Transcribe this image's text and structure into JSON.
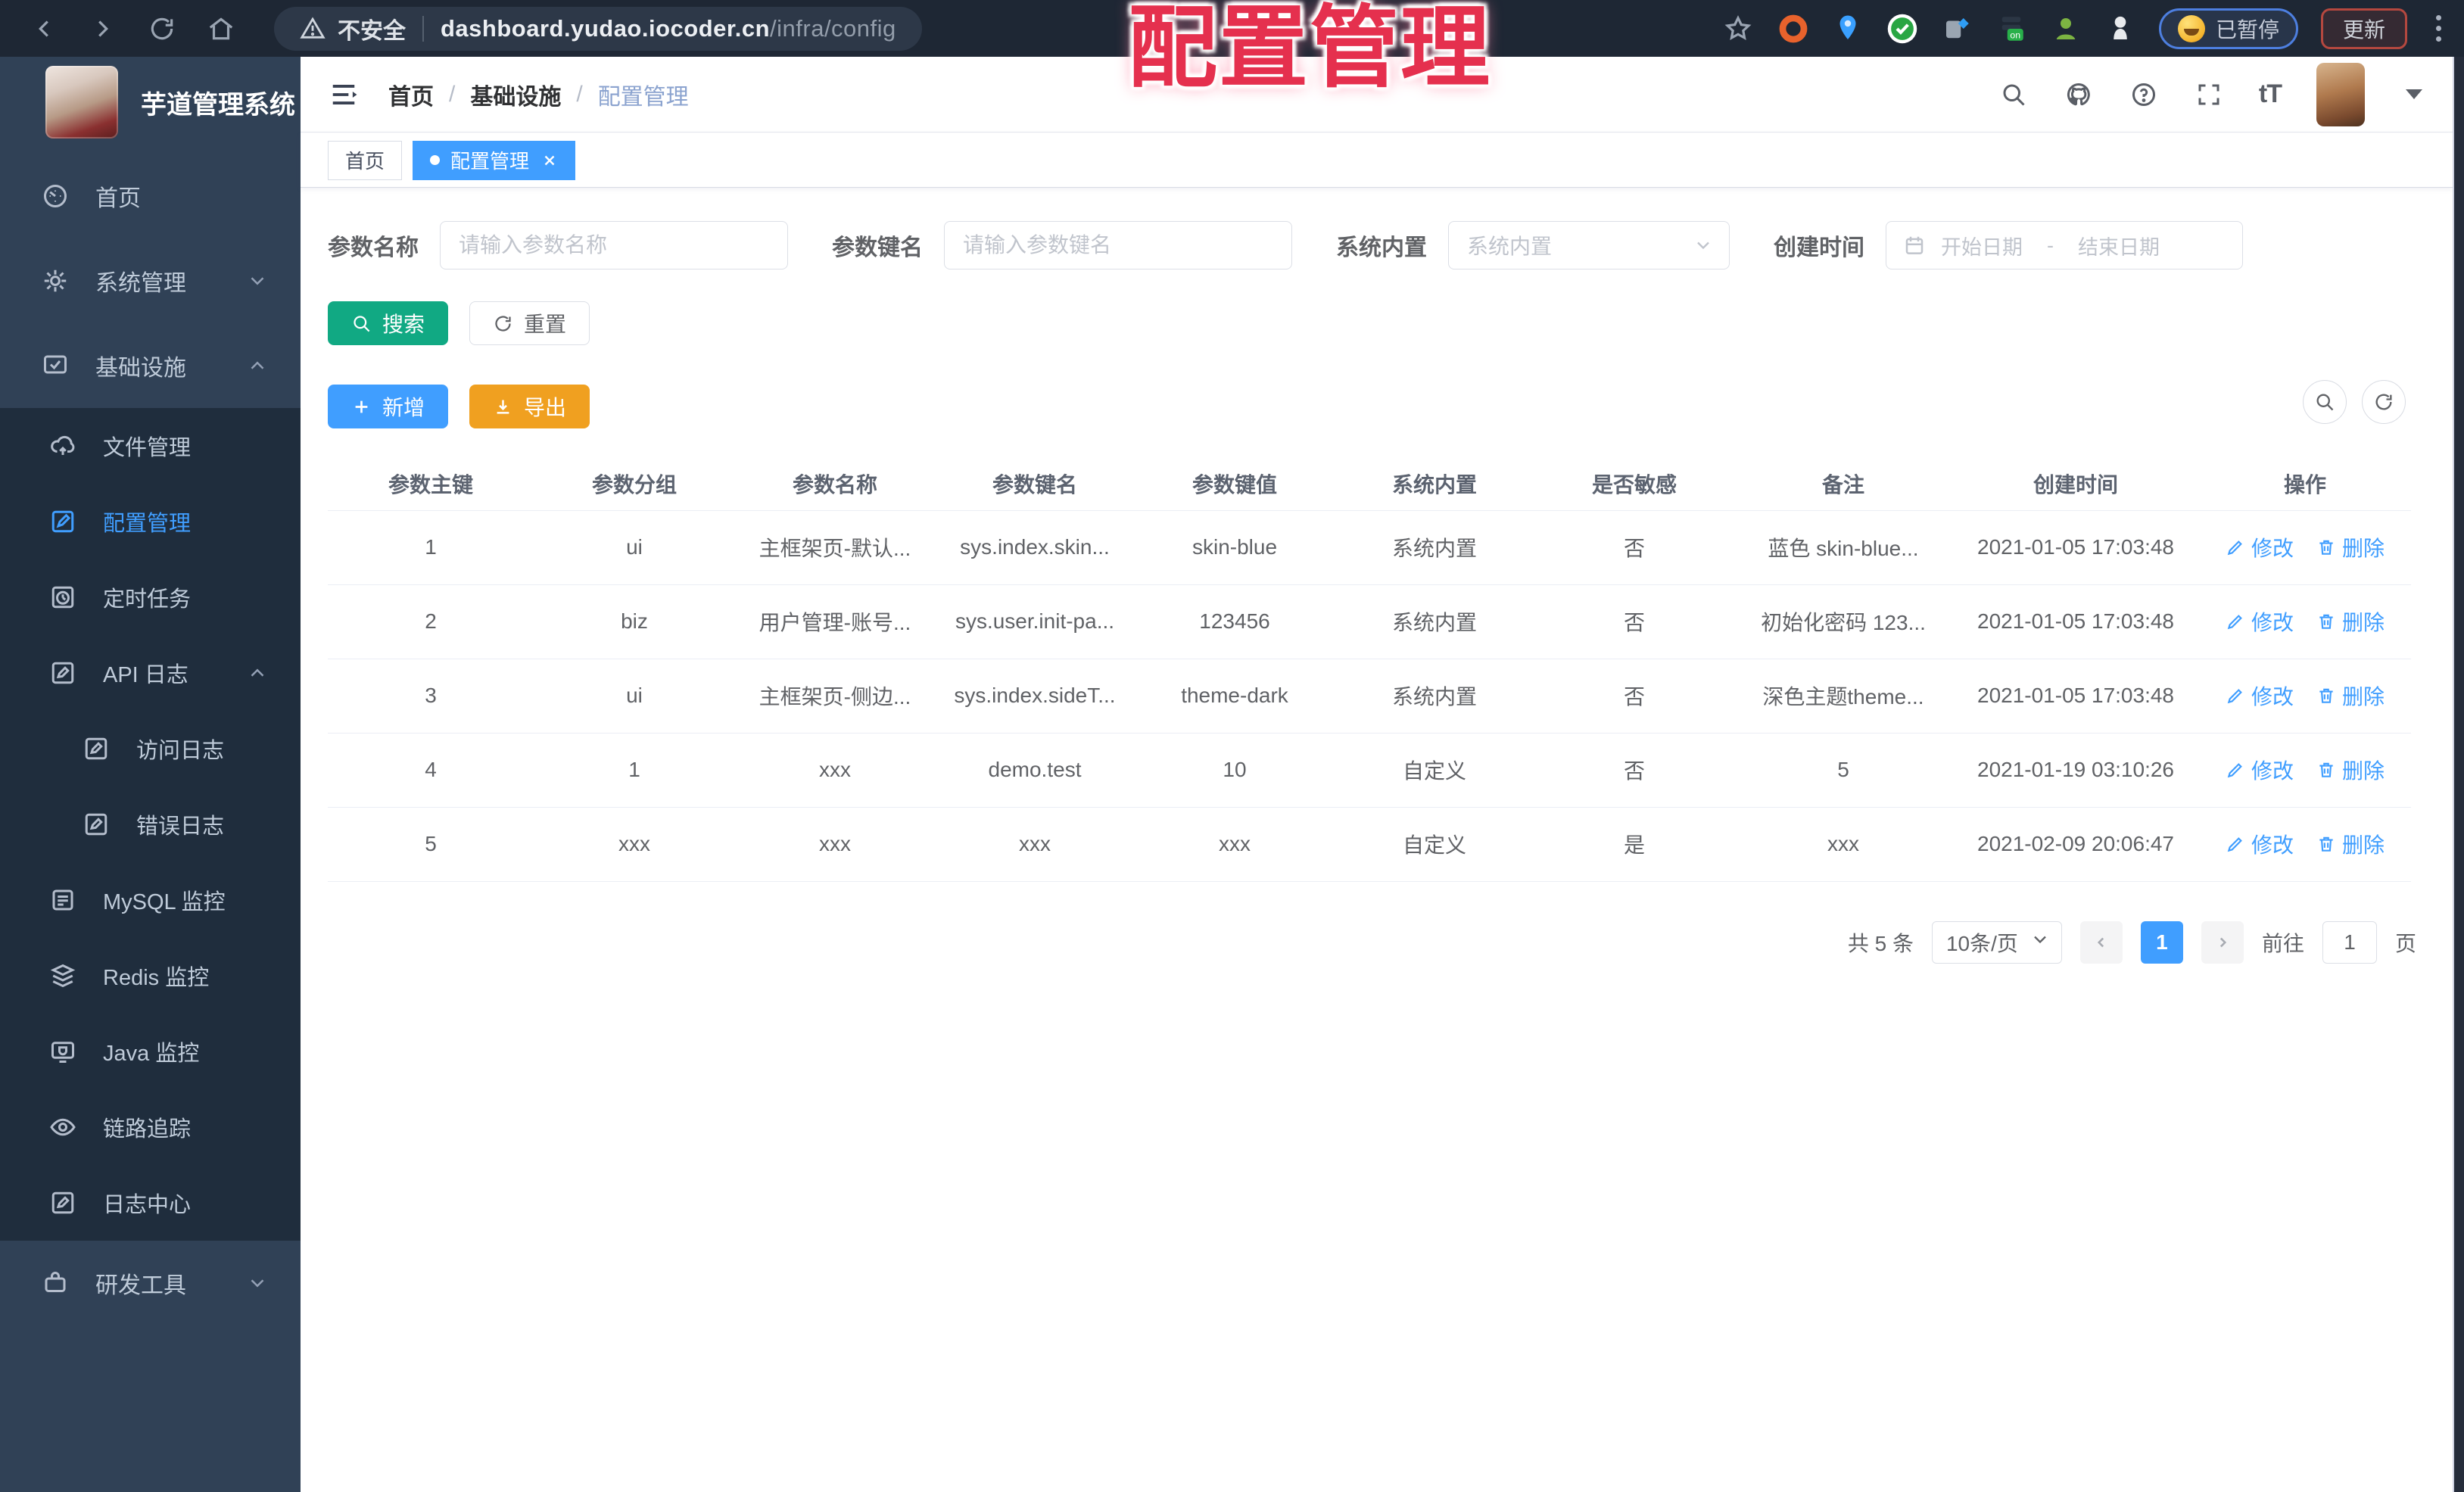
{
  "browser": {
    "security_label": "不安全",
    "url_domain": "dashboard.yudao.iocoder.cn",
    "url_path": "/infra/config",
    "paused_badge": "已暂停",
    "update_label": "更新"
  },
  "overlay_title": "配置管理",
  "sidebar": {
    "app_title": "芋道管理系统",
    "items": [
      {
        "label": "首页"
      },
      {
        "label": "系统管理"
      },
      {
        "label": "基础设施"
      }
    ],
    "sub_items": [
      {
        "label": "文件管理"
      },
      {
        "label": "配置管理"
      },
      {
        "label": "定时任务"
      },
      {
        "label": "API 日志"
      },
      {
        "label": "访问日志"
      },
      {
        "label": "错误日志"
      },
      {
        "label": "MySQL 监控"
      },
      {
        "label": "Redis 监控"
      },
      {
        "label": "Java 监控"
      },
      {
        "label": "链路追踪"
      },
      {
        "label": "日志中心"
      }
    ],
    "dev_tools_label": "研发工具"
  },
  "header": {
    "breadcrumb": [
      "首页",
      "基础设施",
      "配置管理"
    ],
    "separator": "/"
  },
  "tabs": [
    {
      "label": "首页"
    },
    {
      "label": "配置管理"
    }
  ],
  "filters": {
    "name_label": "参数名称",
    "name_placeholder": "请输入参数名称",
    "key_label": "参数键名",
    "key_placeholder": "请输入参数键名",
    "type_label": "系统内置",
    "type_placeholder": "系统内置",
    "time_label": "创建时间",
    "start_placeholder": "开始日期",
    "range_separator": "-",
    "end_placeholder": "结束日期"
  },
  "buttons": {
    "search": "搜索",
    "reset": "重置",
    "add": "新增",
    "export": "导出"
  },
  "table": {
    "columns": [
      "参数主键",
      "参数分组",
      "参数名称",
      "参数键名",
      "参数键值",
      "系统内置",
      "是否敏感",
      "备注",
      "创建时间",
      "操作"
    ],
    "rows": [
      [
        "1",
        "ui",
        "主框架页-默认...",
        "sys.index.skin...",
        "skin-blue",
        "系统内置",
        "否",
        "蓝色 skin-blue...",
        "2021-01-05 17:03:48"
      ],
      [
        "2",
        "biz",
        "用户管理-账号...",
        "sys.user.init-pa...",
        "123456",
        "系统内置",
        "否",
        "初始化密码 123...",
        "2021-01-05 17:03:48"
      ],
      [
        "3",
        "ui",
        "主框架页-侧边...",
        "sys.index.sideT...",
        "theme-dark",
        "系统内置",
        "否",
        "深色主题theme...",
        "2021-01-05 17:03:48"
      ],
      [
        "4",
        "1",
        "xxx",
        "demo.test",
        "10",
        "自定义",
        "否",
        "5",
        "2021-01-19 03:10:26"
      ],
      [
        "5",
        "xxx",
        "xxx",
        "xxx",
        "xxx",
        "自定义",
        "是",
        "xxx",
        "2021-02-09 20:06:47"
      ]
    ],
    "row_actions": {
      "edit": "修改",
      "delete": "删除"
    }
  },
  "pagination": {
    "total": "共 5 条",
    "page_size": "10条/页",
    "page": "1",
    "goto": "前往",
    "goto_value": "1",
    "unit": "页"
  },
  "icons": {
    "browser": [
      "back-icon",
      "forward-icon",
      "reload-icon",
      "home-icon",
      "warning-icon",
      "star-icon",
      "kebab-menu-icon"
    ],
    "header": [
      "hamburger-icon",
      "search-icon",
      "github-icon",
      "help-icon",
      "fullscreen-icon",
      "font-size-icon",
      "caret-down-icon"
    ],
    "colors": {
      "accent": "#409eff",
      "search_button": "#11a983",
      "export_button": "#f0a020",
      "sidebar_bg": "#304156",
      "submenu_bg": "#1f2d3d",
      "overlay_red": "#e5304e"
    }
  }
}
